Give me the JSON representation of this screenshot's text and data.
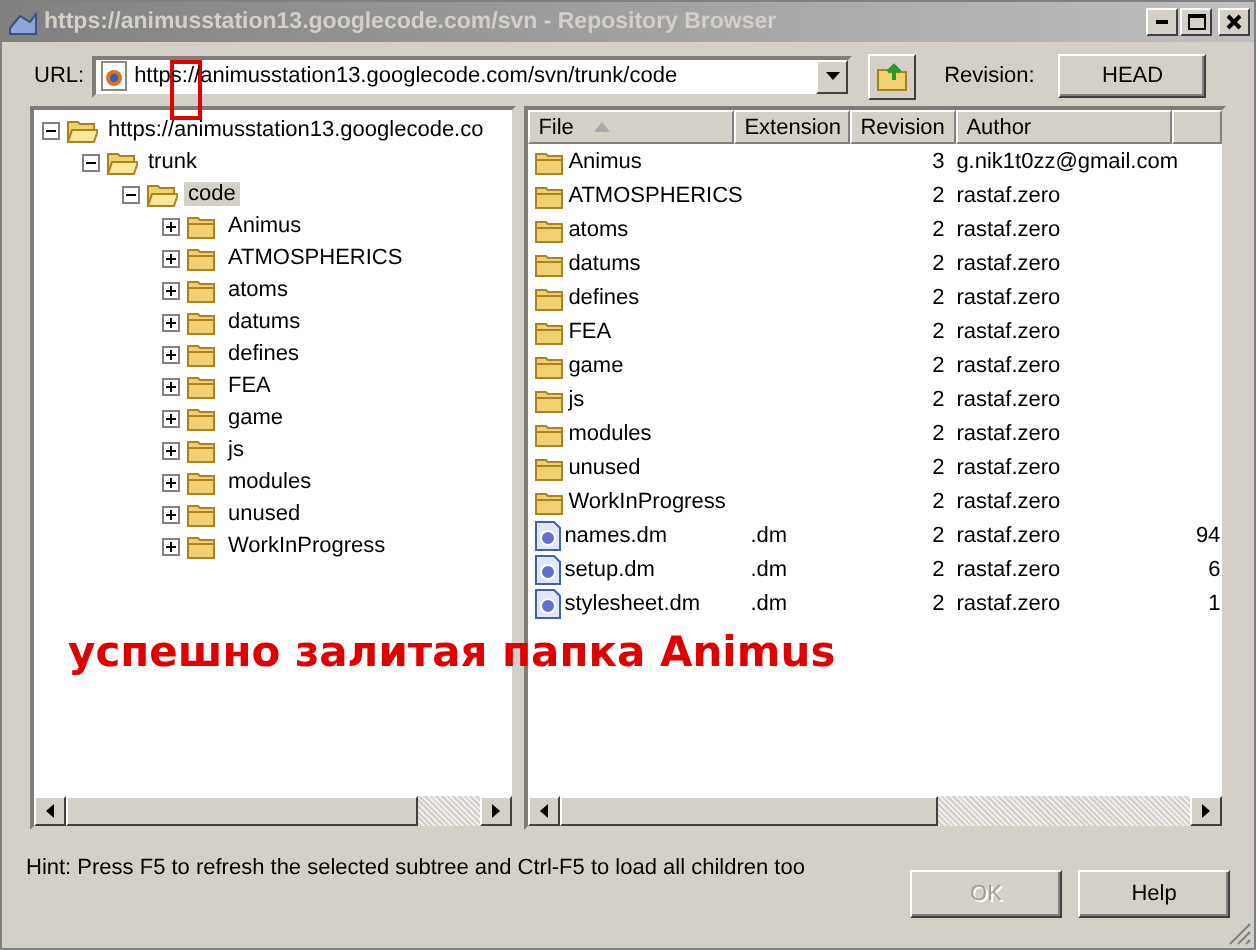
{
  "window": {
    "title": "https://animusstation13.googlecode.com/svn - Repository Browser",
    "active": false
  },
  "toolbar": {
    "url_label": "URL:",
    "url": "https://animusstation13.googlecode.com/svn/trunk/code",
    "revision_label": "Revision:",
    "revision_button": "HEAD"
  },
  "tree": [
    {
      "label": "https://animusstation13.googlecode.co",
      "expanded": true,
      "selected": false,
      "children": [
        {
          "label": "trunk",
          "expanded": true,
          "selected": false,
          "children": [
            {
              "label": "code",
              "expanded": true,
              "selected": true,
              "children": [
                {
                  "label": "Animus",
                  "expanded": false,
                  "selected": false
                },
                {
                  "label": "ATMOSPHERICS",
                  "expanded": false,
                  "selected": false
                },
                {
                  "label": "atoms",
                  "expanded": false,
                  "selected": false
                },
                {
                  "label": "datums",
                  "expanded": false,
                  "selected": false
                },
                {
                  "label": "defines",
                  "expanded": false,
                  "selected": false
                },
                {
                  "label": "FEA",
                  "expanded": false,
                  "selected": false
                },
                {
                  "label": "game",
                  "expanded": false,
                  "selected": false
                },
                {
                  "label": "js",
                  "expanded": false,
                  "selected": false
                },
                {
                  "label": "modules",
                  "expanded": false,
                  "selected": false
                },
                {
                  "label": "unused",
                  "expanded": false,
                  "selected": false
                },
                {
                  "label": "WorkInProgress",
                  "expanded": false,
                  "selected": false
                }
              ]
            }
          ]
        }
      ]
    }
  ],
  "table": {
    "columns": [
      {
        "label": "File",
        "sorted": true
      },
      {
        "label": "Extension",
        "sorted": false
      },
      {
        "label": "Revision",
        "sorted": false
      },
      {
        "label": "Author",
        "sorted": false
      }
    ],
    "rows": [
      {
        "kind": "folder",
        "name": "Animus",
        "revision": "3",
        "author": "g.nik1t0zz@gmail.com"
      },
      {
        "kind": "folder",
        "name": "ATMOSPHERICS",
        "revision": "2",
        "author": "rastaf.zero"
      },
      {
        "kind": "folder",
        "name": "atoms",
        "revision": "2",
        "author": "rastaf.zero"
      },
      {
        "kind": "folder",
        "name": "datums",
        "revision": "2",
        "author": "rastaf.zero"
      },
      {
        "kind": "folder",
        "name": "defines",
        "revision": "2",
        "author": "rastaf.zero"
      },
      {
        "kind": "folder",
        "name": "FEA",
        "revision": "2",
        "author": "rastaf.zero"
      },
      {
        "kind": "folder",
        "name": "game",
        "revision": "2",
        "author": "rastaf.zero"
      },
      {
        "kind": "folder",
        "name": "js",
        "revision": "2",
        "author": "rastaf.zero"
      },
      {
        "kind": "folder",
        "name": "modules",
        "revision": "2",
        "author": "rastaf.zero"
      },
      {
        "kind": "folder",
        "name": "unused",
        "revision": "2",
        "author": "rastaf.zero"
      },
      {
        "kind": "folder",
        "name": "WorkInProgress",
        "revision": "2",
        "author": "rastaf.zero"
      },
      {
        "kind": "file",
        "name": "names.dm",
        "extension": ".dm",
        "revision": "2",
        "author": "rastaf.zero",
        "column_5": "94"
      },
      {
        "kind": "file",
        "name": "setup.dm",
        "extension": ".dm",
        "revision": "2",
        "author": "rastaf.zero",
        "column_5": "6"
      },
      {
        "kind": "file",
        "name": "stylesheet.dm",
        "extension": ".dm",
        "revision": "2",
        "author": "rastaf.zero",
        "column_5": "1"
      }
    ]
  },
  "hint": "Hint: Press F5 to refresh the selected subtree and Ctrl-F5 to load all children too",
  "buttons": [
    {
      "label": "OK",
      "disabled": true
    },
    {
      "label": "Help",
      "disabled": false
    }
  ],
  "annotation": {
    "text": "успешно залитая папка Animus"
  }
}
